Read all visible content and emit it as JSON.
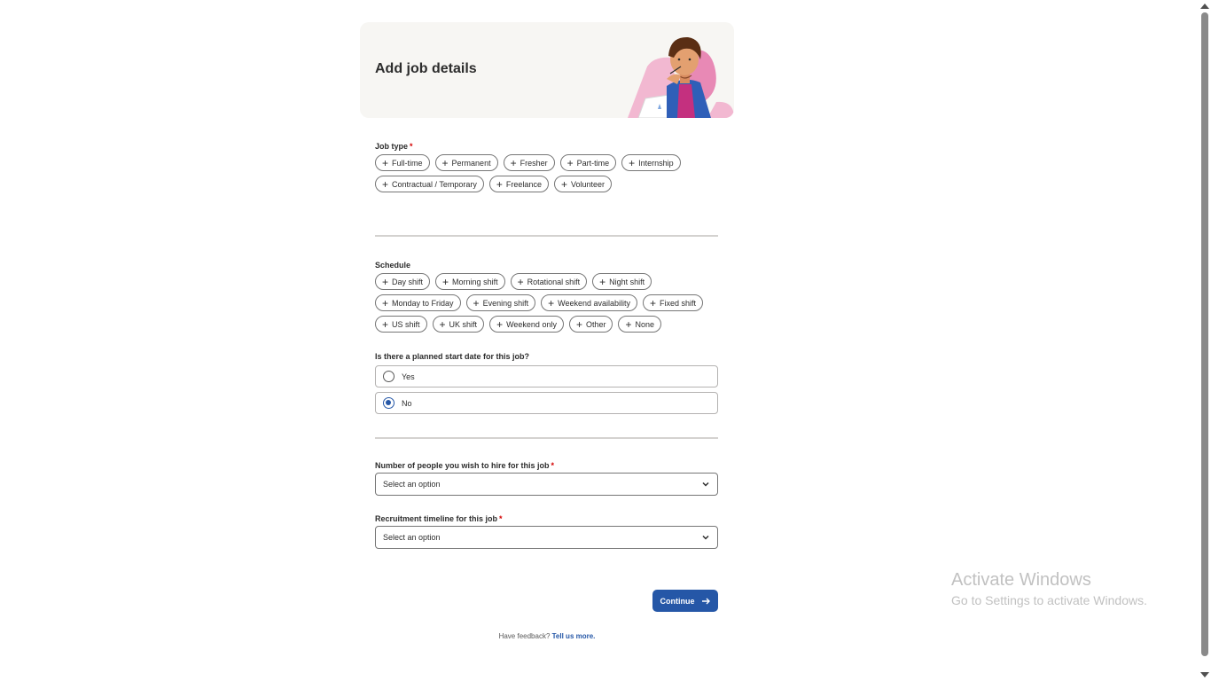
{
  "header": {
    "title": "Add job details"
  },
  "job_type": {
    "label": "Job type",
    "required_mark": "*",
    "options": [
      "Full-time",
      "Permanent",
      "Fresher",
      "Part-time",
      "Internship",
      "Contractual / Temporary",
      "Freelance",
      "Volunteer"
    ]
  },
  "schedule": {
    "label": "Schedule",
    "options": [
      "Day shift",
      "Morning shift",
      "Rotational shift",
      "Night shift",
      "Monday to Friday",
      "Evening shift",
      "Weekend availability",
      "Fixed shift",
      "US shift",
      "UK shift",
      "Weekend only",
      "Other",
      "None"
    ]
  },
  "start_date": {
    "question": "Is there a planned start date for this job?",
    "options": [
      {
        "label": "Yes",
        "checked": false
      },
      {
        "label": "No",
        "checked": true
      }
    ]
  },
  "hires": {
    "label": "Number of people you wish to hire for this job",
    "required_mark": "*",
    "value": "Select an option"
  },
  "timeline": {
    "label": "Recruitment timeline for this job",
    "required_mark": "*",
    "value": "Select an option"
  },
  "actions": {
    "continue_label": "Continue"
  },
  "feedback": {
    "text": "Have feedback?",
    "link": "Tell us more."
  },
  "watermark": {
    "title": "Activate Windows",
    "subtitle": "Go to Settings to activate Windows."
  },
  "colors": {
    "accent": "#2557a7",
    "required": "#d40000",
    "header_bg": "#f7f6f3"
  },
  "icons": {
    "chip": "plus-icon",
    "select": "chevron-down-icon",
    "continue": "arrow-right-icon"
  }
}
